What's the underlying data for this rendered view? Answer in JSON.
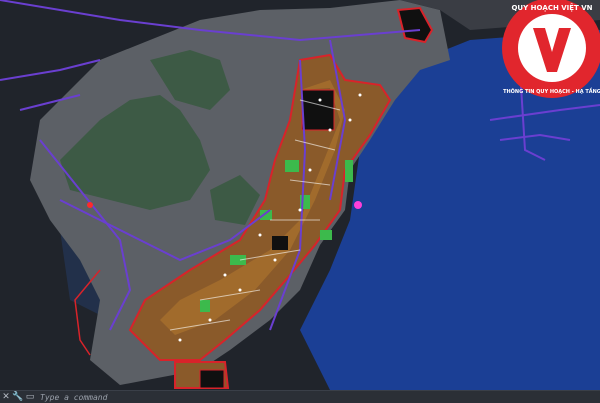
{
  "command_line": {
    "placeholder": "Type a command"
  },
  "logo": {
    "letter": "V",
    "top_text": "QUY HOẠCH VIỆT VN",
    "bottom_text": "THÔNG TIN QUY HOẠCH - HẠ TẦNG"
  },
  "colors": {
    "sea": "#1b3f95",
    "land": "#5c6066",
    "forest": "#3d5a45",
    "urban": "#8a5a2a",
    "boundary": "#d8232a",
    "roads": "#6a3fd0",
    "logo_red": "#e1262d"
  },
  "icons": {
    "close": "close-icon",
    "wrench": "wrench-icon",
    "prompt": "command-prompt-icon"
  }
}
